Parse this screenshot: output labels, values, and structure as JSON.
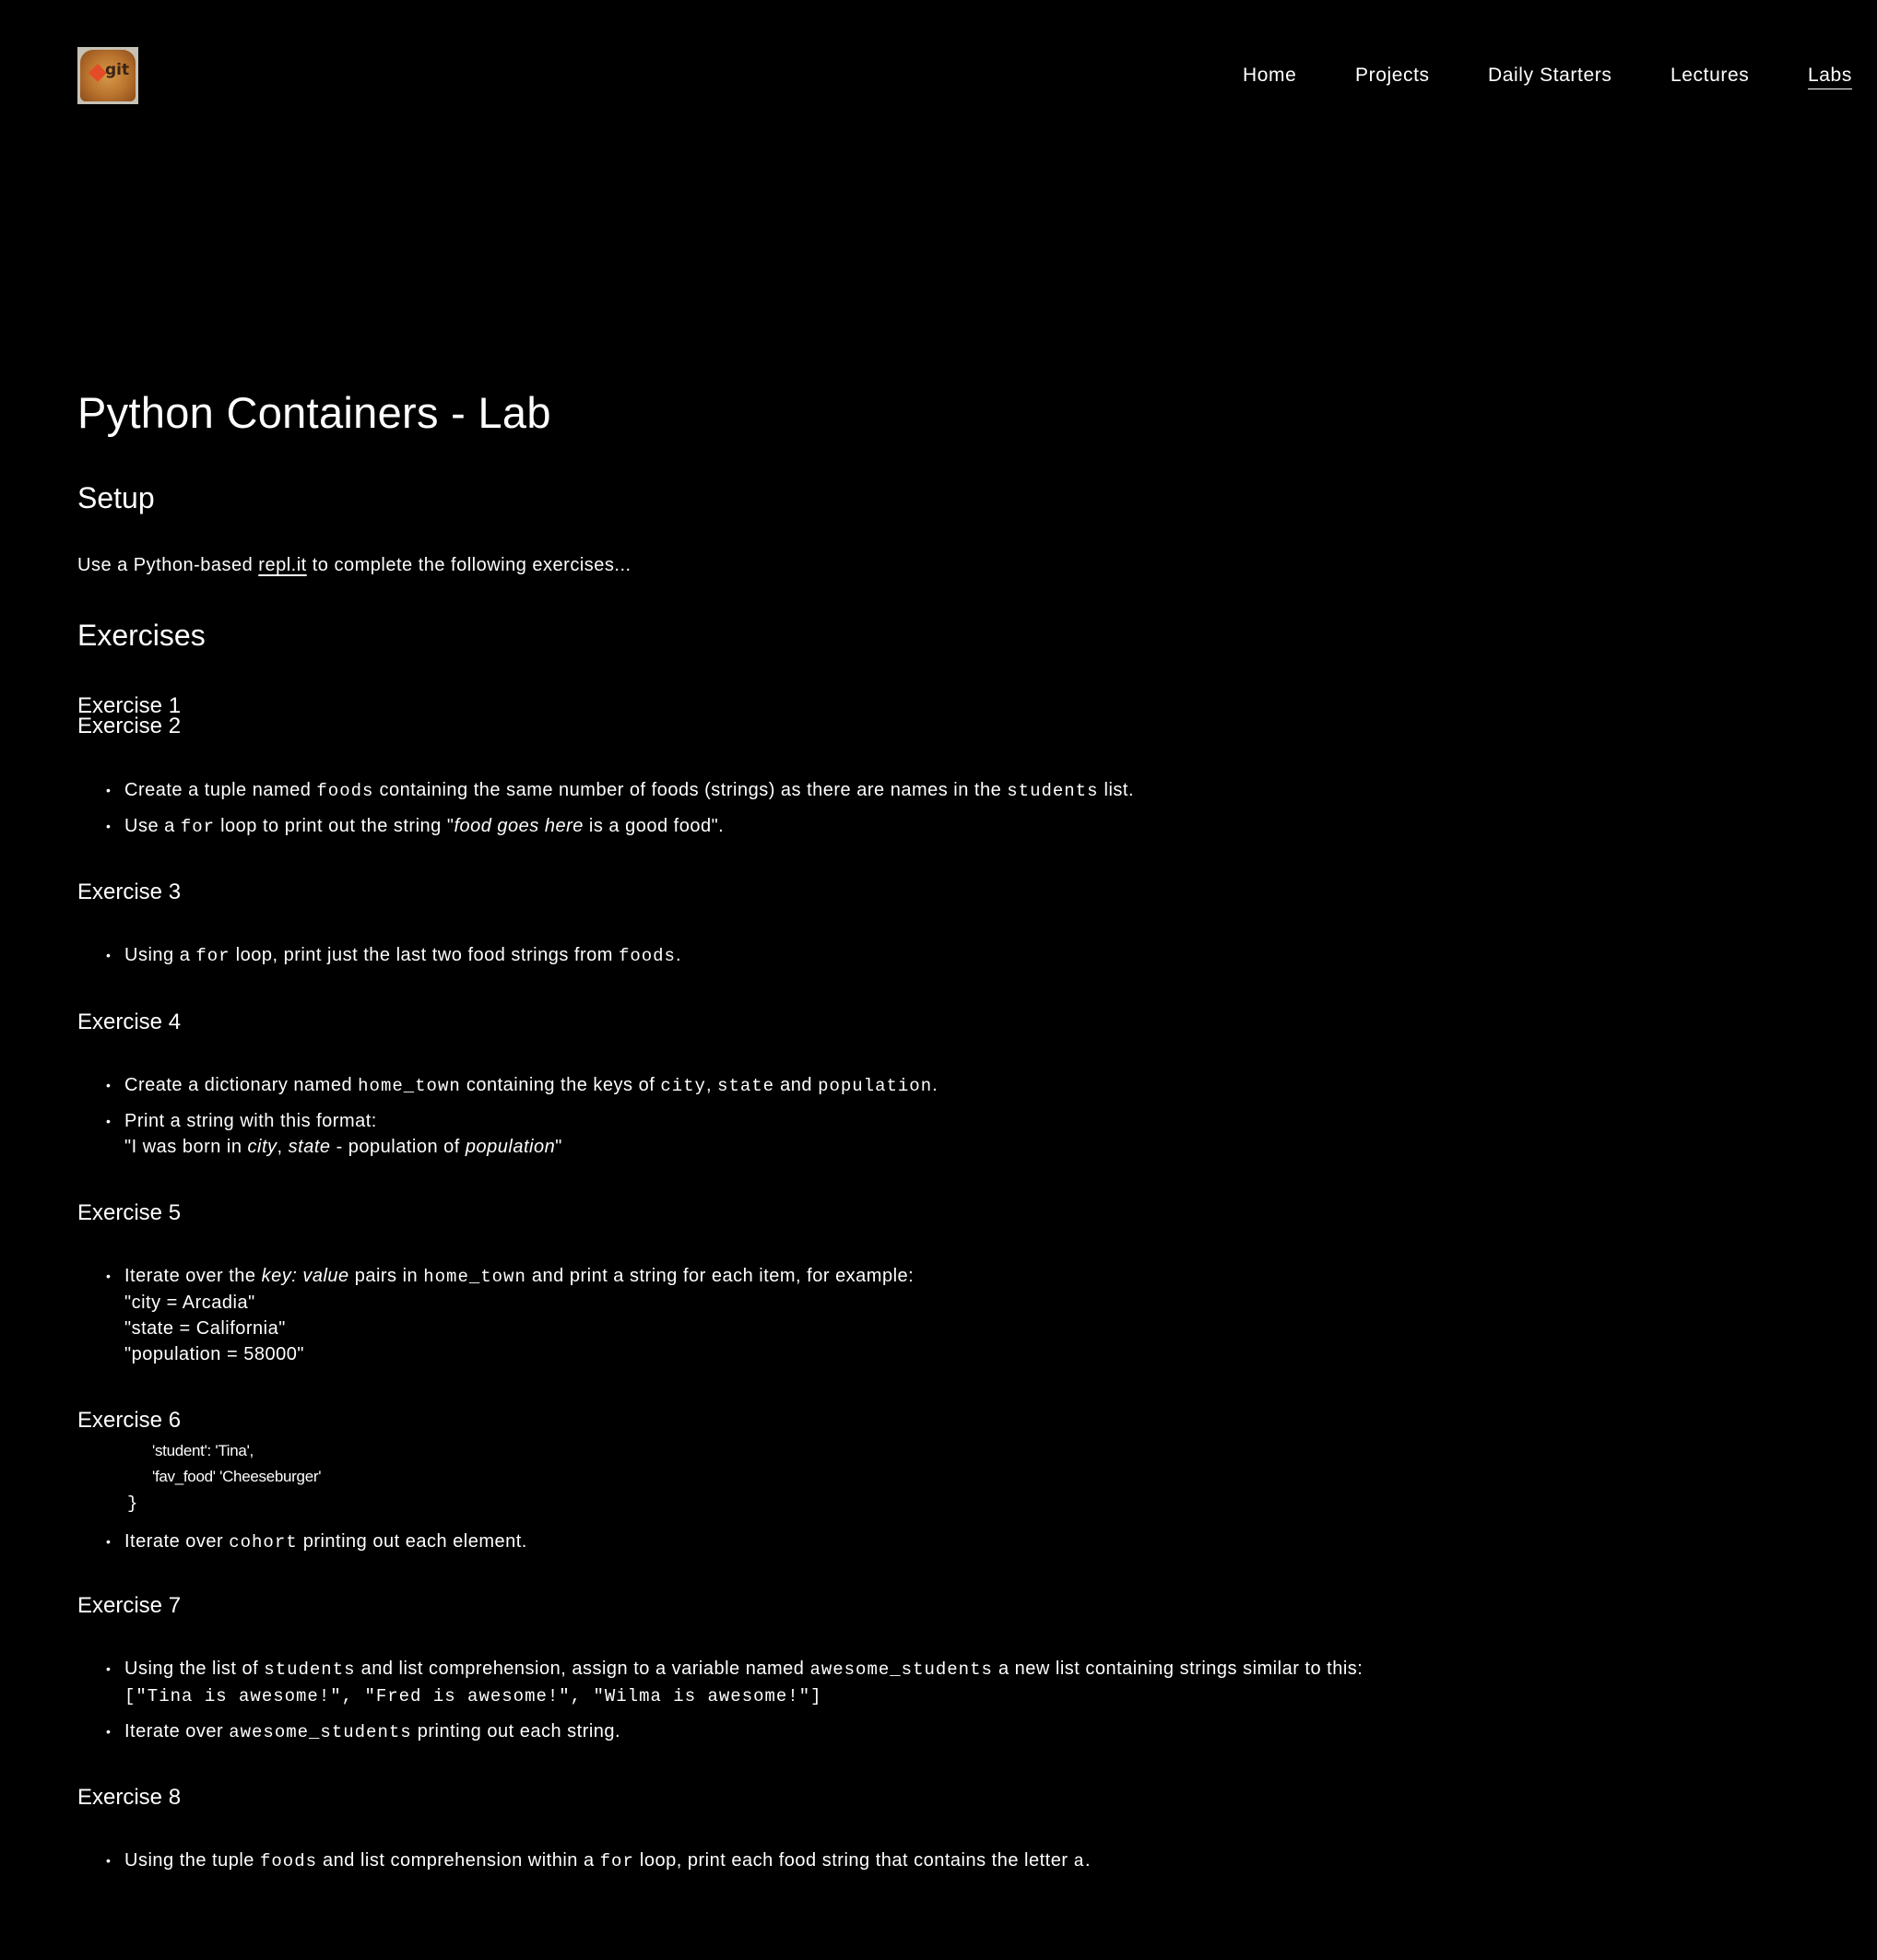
{
  "header": {
    "logo_text": "git",
    "nav": [
      "Home",
      "Projects",
      "Daily Starters",
      "Lectures",
      "Labs"
    ]
  },
  "page": {
    "title": "Python Containers - Lab",
    "setup_heading": "Setup",
    "setup_text_before": "Use a Python-based ",
    "setup_link": "repl.it",
    "setup_text_after": " to complete the following exercises...",
    "exercises_heading": "Exercises"
  },
  "ex1": {
    "heading": "Exercise 1"
  },
  "ex2": {
    "heading": "Exercise 2",
    "b1": [
      "Create a tuple named ",
      "foods",
      " containing the same number of foods (strings) as there are names in the ",
      "students",
      " list."
    ],
    "b2": [
      "Use a ",
      "for",
      " loop to print out the string \"",
      "food goes here",
      " is a good food\"."
    ]
  },
  "ex3": {
    "heading": "Exercise 3",
    "b1": [
      "Using a ",
      "for",
      " loop, print just the last two food strings from ",
      "foods",
      "."
    ]
  },
  "ex4": {
    "heading": "Exercise 4",
    "b1": [
      "Create a dictionary named ",
      "home_town",
      " containing the keys of ",
      "city",
      ", ",
      "state",
      " and ",
      "population",
      "."
    ],
    "b2_line1": "Print a string with this format:",
    "b2_line2": [
      "\"I was born in ",
      "city",
      ", ",
      "state",
      " - population of ",
      "population",
      "\""
    ]
  },
  "ex5": {
    "heading": "Exercise 5",
    "b1": [
      "Iterate over the ",
      "key: value",
      " pairs in ",
      "home_town",
      " and print a string for each item, for example:"
    ],
    "lines": [
      "\"city = Arcadia\"",
      "\"state = California\"",
      "\"population = 58000\""
    ]
  },
  "ex6": {
    "heading": "Exercise 6",
    "code_lines": [
      "'student': 'Tina',",
      "'fav_food' 'Cheeseburger'",
      "}"
    ],
    "b1": [
      "Iterate over ",
      "cohort",
      " printing out each element."
    ]
  },
  "ex7": {
    "heading": "Exercise 7",
    "b1": [
      "Using the list of ",
      "students",
      " and list comprehension, assign to a variable named ",
      "awesome_students",
      " a new list containing strings similar to this:"
    ],
    "b1_code": "[\"Tina is awesome!\", \"Fred is awesome!\", \"Wilma is awesome!\"]",
    "b2": [
      "Iterate over ",
      "awesome_students",
      " printing out each string."
    ]
  },
  "ex8": {
    "heading": "Exercise 8",
    "b1": [
      "Using the tuple ",
      "foods",
      " and list comprehension within a ",
      "for",
      " loop, print each food string that contains the letter ",
      "a",
      "."
    ]
  }
}
